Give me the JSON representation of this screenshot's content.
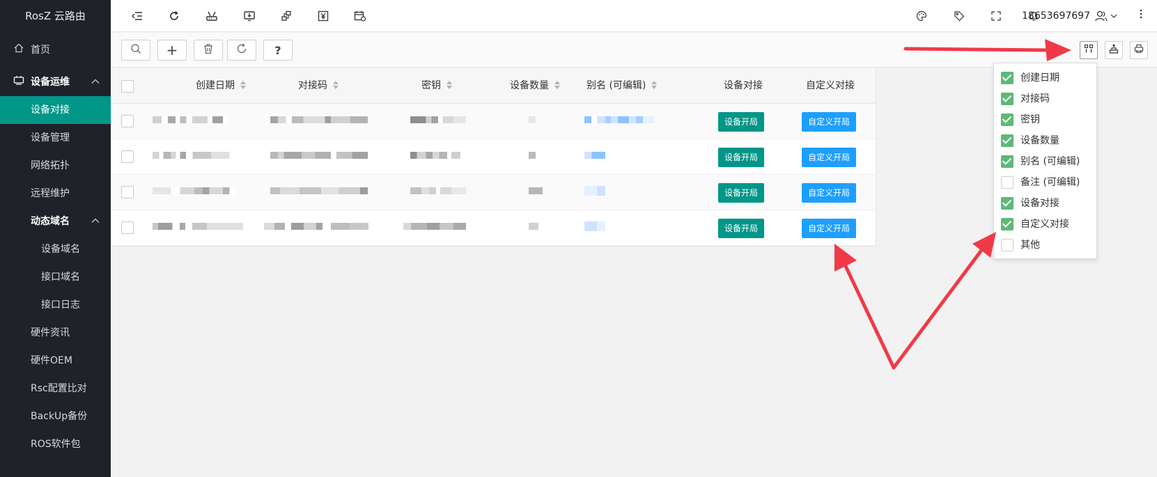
{
  "app": {
    "title": "RosZ 云路由"
  },
  "sidebar": {
    "items": [
      {
        "label": "首页",
        "type": "home"
      },
      {
        "label": "设备运维",
        "type": "group"
      },
      {
        "label": "设备对接",
        "type": "active"
      },
      {
        "label": "设备管理",
        "type": "item"
      },
      {
        "label": "网络拓扑",
        "type": "item"
      },
      {
        "label": "远程维护",
        "type": "item"
      },
      {
        "label": "动态域名",
        "type": "subgroup"
      },
      {
        "label": "设备域名",
        "type": "sub2"
      },
      {
        "label": "接口域名",
        "type": "sub2"
      },
      {
        "label": "接口日志",
        "type": "sub2"
      },
      {
        "label": "硬件资讯",
        "type": "item"
      },
      {
        "label": "硬件OEM",
        "type": "item"
      },
      {
        "label": "Rsc配置比对",
        "type": "item"
      },
      {
        "label": "BackUp备份",
        "type": "item"
      },
      {
        "label": "ROS软件包",
        "type": "item"
      }
    ]
  },
  "header": {
    "username": "18653697697",
    "icons": [
      "menu-toggle-icon",
      "refresh-icon",
      "router-icon",
      "download-screen-icon",
      "network-icon",
      "yen-icon",
      "calendar-icon",
      "palette-icon",
      "tag-icon",
      "fullscreen-icon",
      "bell-icon",
      "user-icon",
      "more-icon"
    ]
  },
  "toolbar": {
    "add_label": "+",
    "help_label": "?"
  },
  "table": {
    "columns": [
      {
        "label": "创建日期",
        "sortable": true
      },
      {
        "label": "对接码",
        "sortable": true
      },
      {
        "label": "密钥",
        "sortable": true
      },
      {
        "label": "设备数量",
        "sortable": true
      },
      {
        "label": "别名 (可编辑)",
        "sortable": true
      },
      {
        "label": "设备对接",
        "sortable": false
      },
      {
        "label": "自定义对接",
        "sortable": false
      }
    ],
    "row_buttons": {
      "device": "设备开局",
      "custom": "自定义开局"
    },
    "row_count": 4
  },
  "column_panel": {
    "items": [
      {
        "label": "创建日期",
        "checked": true
      },
      {
        "label": "对接码",
        "checked": true
      },
      {
        "label": "密钥",
        "checked": true
      },
      {
        "label": "设备数量",
        "checked": true
      },
      {
        "label": "别名 (可编辑)",
        "checked": true
      },
      {
        "label": "备注 (可编辑)",
        "checked": false
      },
      {
        "label": "设备对接",
        "checked": true
      },
      {
        "label": "自定义对接",
        "checked": true
      },
      {
        "label": "其他",
        "checked": false
      }
    ]
  },
  "colors": {
    "sidebar_bg": "#20222a",
    "active": "#009688",
    "blue_button": "#1e9fff",
    "check_green": "#5fb878",
    "annotation_arrow": "#f03a47"
  }
}
